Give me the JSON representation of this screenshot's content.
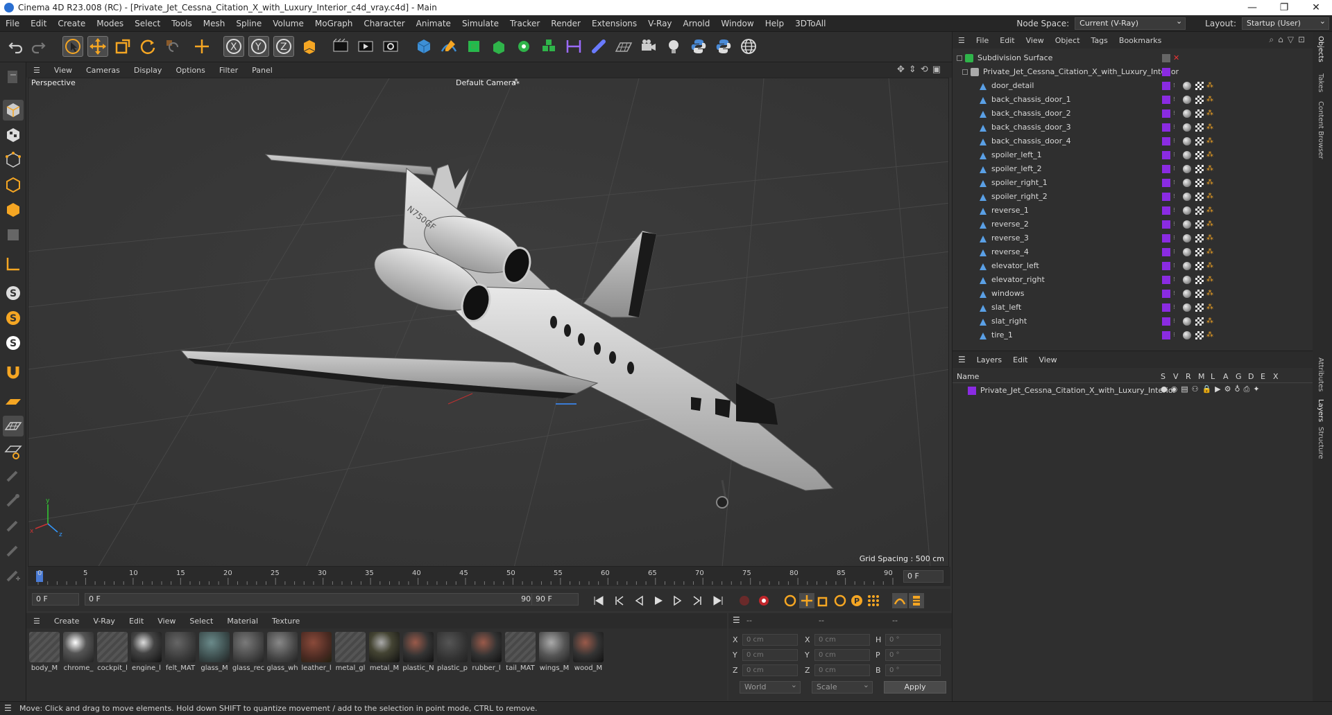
{
  "window": {
    "title": "Cinema 4D R23.008 (RC) - [Private_Jet_Cessna_Citation_X_with_Luxury_Interior_c4d_vray.c4d] - Main"
  },
  "menu": {
    "items": [
      "File",
      "Edit",
      "Create",
      "Modes",
      "Select",
      "Tools",
      "Mesh",
      "Spline",
      "Volume",
      "MoGraph",
      "Character",
      "Animate",
      "Simulate",
      "Tracker",
      "Render",
      "Extensions",
      "V-Ray",
      "Arnold",
      "Window",
      "Help",
      "3DToAll"
    ],
    "node_space_label": "Node Space:",
    "node_space_value": "Current (V-Ray)",
    "layout_label": "Layout:",
    "layout_value": "Startup (User)"
  },
  "viewport": {
    "menu": [
      "View",
      "Cameras",
      "Display",
      "Options",
      "Filter",
      "Panel"
    ],
    "name": "Perspective",
    "camera": "Default Camera",
    "grid_spacing": "Grid Spacing : 500 cm",
    "tail_number": "N750GF"
  },
  "timeline": {
    "ticks": [
      "0",
      "5",
      "10",
      "15",
      "20",
      "25",
      "30",
      "35",
      "40",
      "45",
      "50",
      "55",
      "60",
      "65",
      "70",
      "75",
      "80",
      "85",
      "90"
    ],
    "current_frame_right": "0 F",
    "start_field": "0 F",
    "range_start": "0 F",
    "range_end": "90 F",
    "end_field": "90 F"
  },
  "materials": {
    "menu": [
      "Create",
      "V-Ray",
      "Edit",
      "View",
      "Select",
      "Material",
      "Texture"
    ],
    "items": [
      "body_M",
      "chrome_",
      "cockpit_l",
      "engine_l",
      "felt_MAT",
      "glass_M",
      "glass_rec",
      "glass_wh",
      "leather_l",
      "metal_gl",
      "metal_M",
      "plastic_N",
      "plastic_p",
      "rubber_l",
      "tail_MAT",
      "wings_M",
      "wood_M"
    ]
  },
  "coordinates": {
    "header_a": "--",
    "header_b": "--",
    "header_c": "--",
    "labels_left": [
      "X",
      "Y",
      "Z"
    ],
    "labels_mid": [
      "X",
      "Y",
      "Z"
    ],
    "labels_right": [
      "H",
      "P",
      "B"
    ],
    "pos_values": [
      "0 cm",
      "0 cm",
      "0 cm"
    ],
    "size_values": [
      "0 cm",
      "0 cm",
      "0 cm"
    ],
    "rot_values": [
      "0 °",
      "0 °",
      "0 °"
    ],
    "mode_world": "World",
    "mode_scale": "Scale",
    "apply": "Apply"
  },
  "objects": {
    "menu": [
      "File",
      "Edit",
      "View",
      "Object",
      "Tags",
      "Bookmarks"
    ],
    "root": "Subdivision Surface",
    "group": "Private_Jet_Cessna_Citation_X_with_Luxury_Interior",
    "children": [
      "door_detail",
      "back_chassis_door_1",
      "back_chassis_door_2",
      "back_chassis_door_3",
      "back_chassis_door_4",
      "spoiler_left_1",
      "spoiler_left_2",
      "spoiler_right_1",
      "spoiler_right_2",
      "reverse_1",
      "reverse_2",
      "reverse_3",
      "reverse_4",
      "elevator_left",
      "elevator_right",
      "windows",
      "slat_left",
      "slat_right",
      "tire_1"
    ]
  },
  "layers": {
    "menu": [
      "Layers",
      "Edit",
      "View"
    ],
    "col_name": "Name",
    "col_flags": [
      "S",
      "V",
      "R",
      "M",
      "L",
      "A",
      "G",
      "D",
      "E",
      "X"
    ],
    "rows": [
      "Private_Jet_Cessna_Citation_X_with_Luxury_Interior"
    ]
  },
  "right_tabs": [
    "Objects",
    "Takes",
    "Content Browser",
    "Attributes",
    "Layers",
    "Structure"
  ],
  "status": "Move: Click and drag to move elements. Hold down SHIFT to quantize movement / add to the selection in point mode, CTRL to remove.",
  "colors": {
    "accent": "#f5a623",
    "layer_purple": "#8a2be2",
    "bg": "#333333"
  }
}
